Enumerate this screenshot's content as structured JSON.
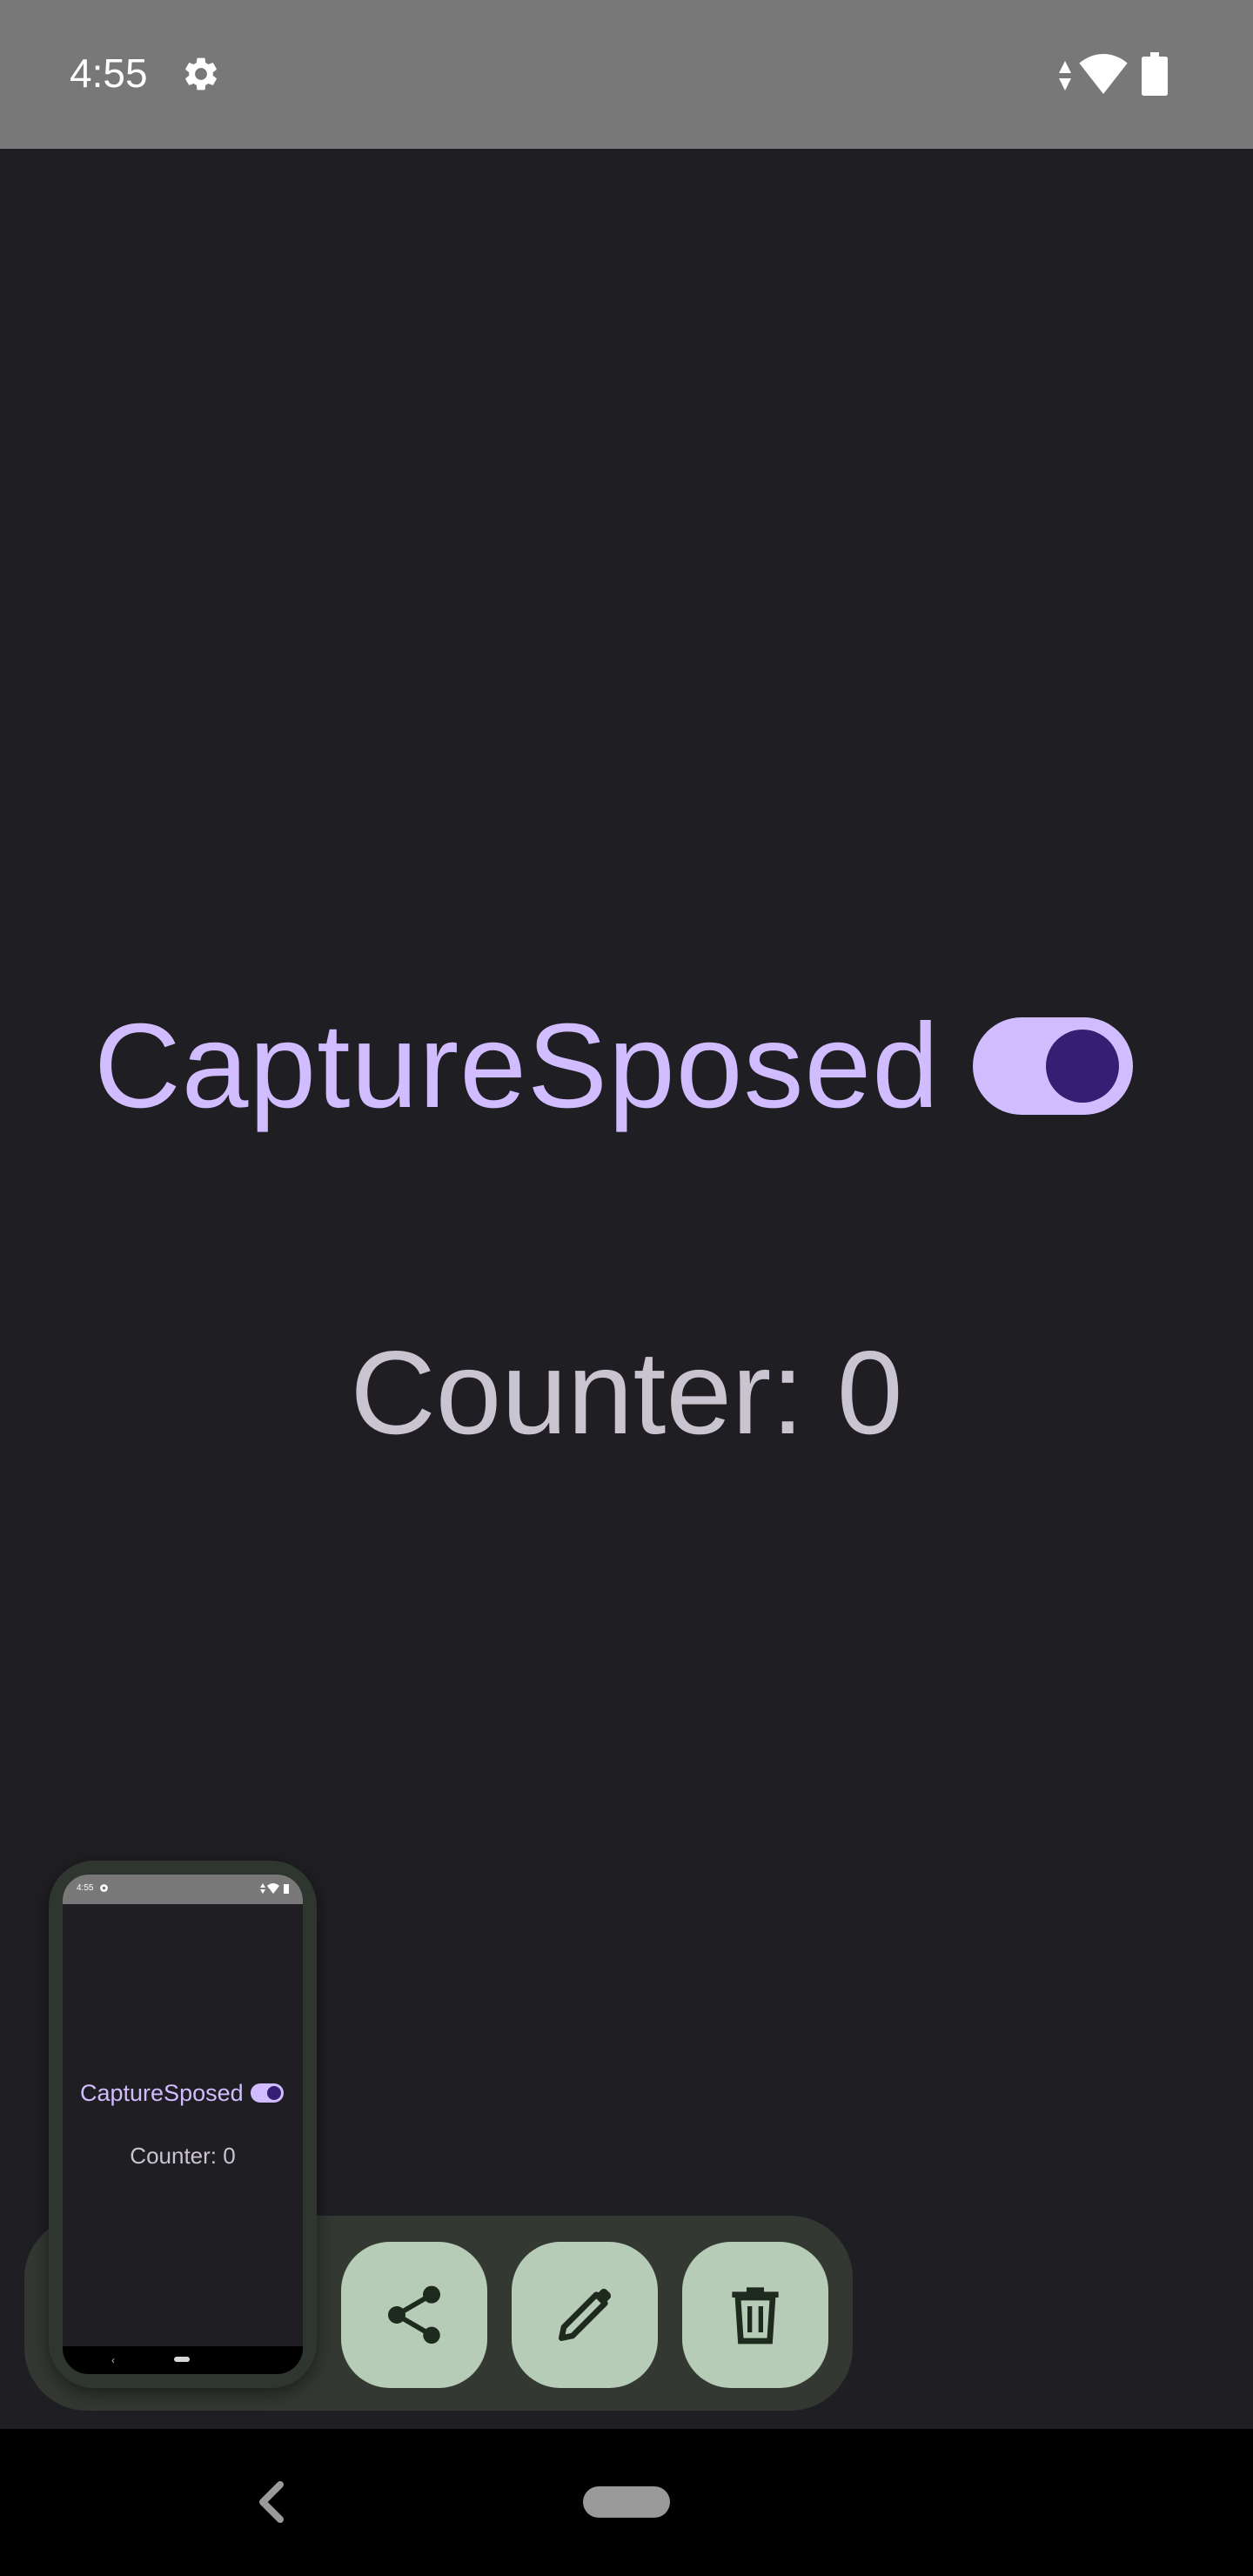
{
  "status_bar": {
    "time": "4:55",
    "icons": [
      "gear-icon",
      "data-arrows-icon",
      "wifi-icon",
      "battery-icon"
    ]
  },
  "app": {
    "title": "CaptureSposed",
    "toggle_state": "on",
    "counter_text": "Counter: 0"
  },
  "screenshot_preview": {
    "time": "4:55",
    "title": "CaptureSposed",
    "counter_text": "Counter: 0",
    "back_glyph": "‹"
  },
  "toolbar": {
    "buttons": [
      "share-icon",
      "edit-icon",
      "delete-icon"
    ]
  },
  "nav_bar": {
    "buttons": [
      "back",
      "home"
    ]
  },
  "colors": {
    "background": "#1f1e22",
    "accent": "#d0bcff",
    "toggle_thumb": "#381e72",
    "counter_text": "#cac4d0",
    "toolbar_bg": "#333833",
    "tool_button": "#b7ccb6",
    "status_bar": "#787878"
  }
}
